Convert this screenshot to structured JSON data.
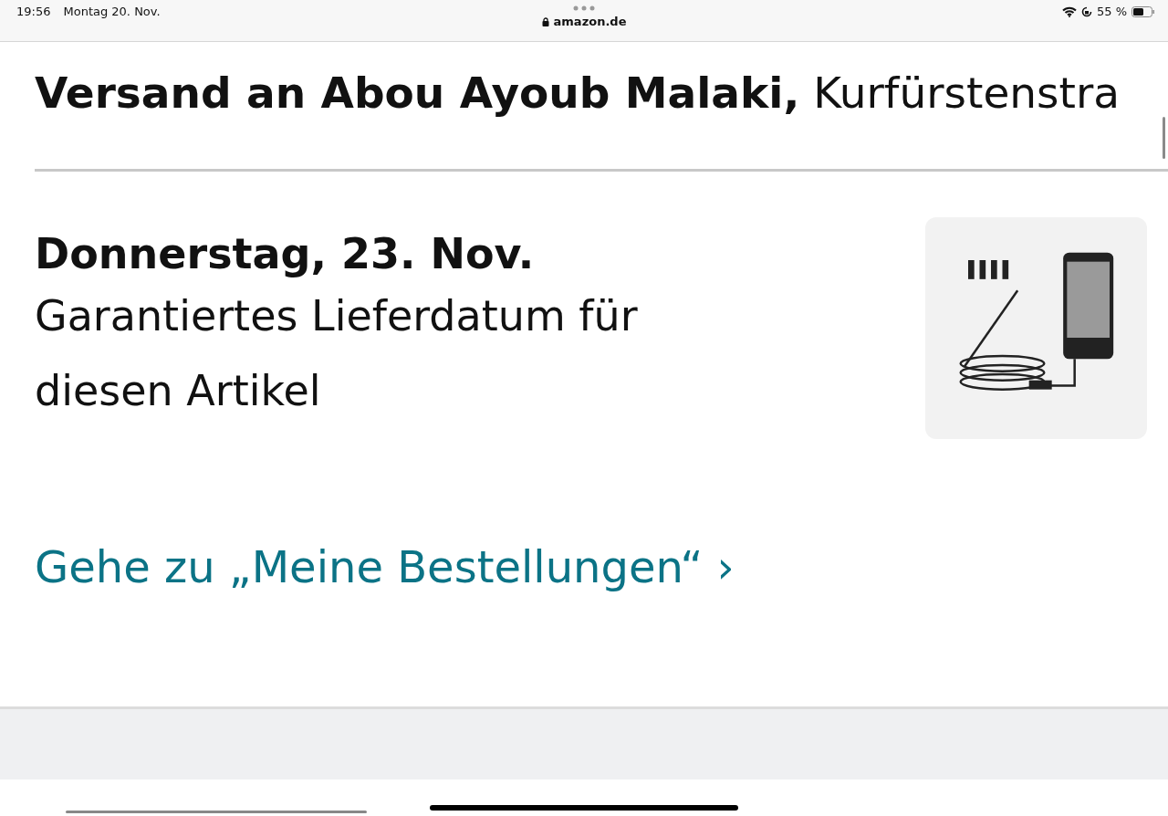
{
  "status_bar": {
    "time": "19:56",
    "date": "Montag 20. Nov.",
    "url": "amazon.de",
    "battery": "55 %"
  },
  "shipping_heading": "**Versand an Abou Ayoub Malaki,** Kurfürstenstra",
  "delivery": {
    "date": "Donnerstag, 23. Nov.",
    "note": "Garantiertes Lieferdatum für diesen Artikel"
  },
  "orders_link": {
    "label": "Gehe zu „Meine Bestellungen“",
    "chevron": "›"
  }
}
